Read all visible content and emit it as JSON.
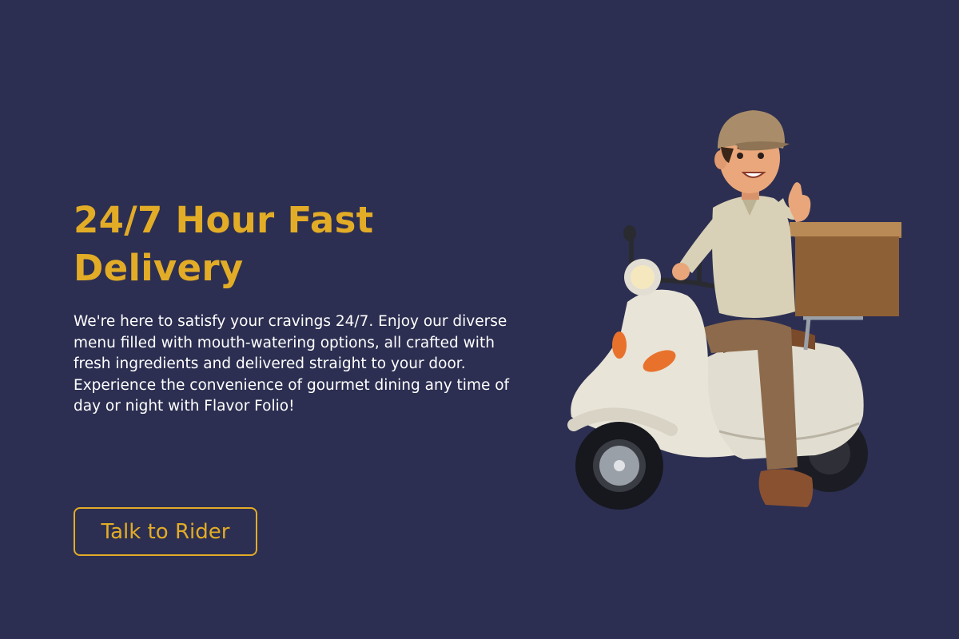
{
  "hero": {
    "headline_line1": "24/7 Hour Fast",
    "headline_line2": "Delivery",
    "description": "We're here to satisfy your cravings 24/7. Enjoy our diverse menu filled with mouth-watering options, all crafted with fresh ingredients and delivered straight to your door. Experience the convenience of gourmet dining any time of day or night with Flavor Folio!",
    "cta_label": "Talk to Rider"
  },
  "colors": {
    "background": "#2c2f51",
    "accent": "#e3ac27",
    "text": "#ffffff"
  },
  "illustration": {
    "icon": "delivery-rider-scooter-icon"
  }
}
